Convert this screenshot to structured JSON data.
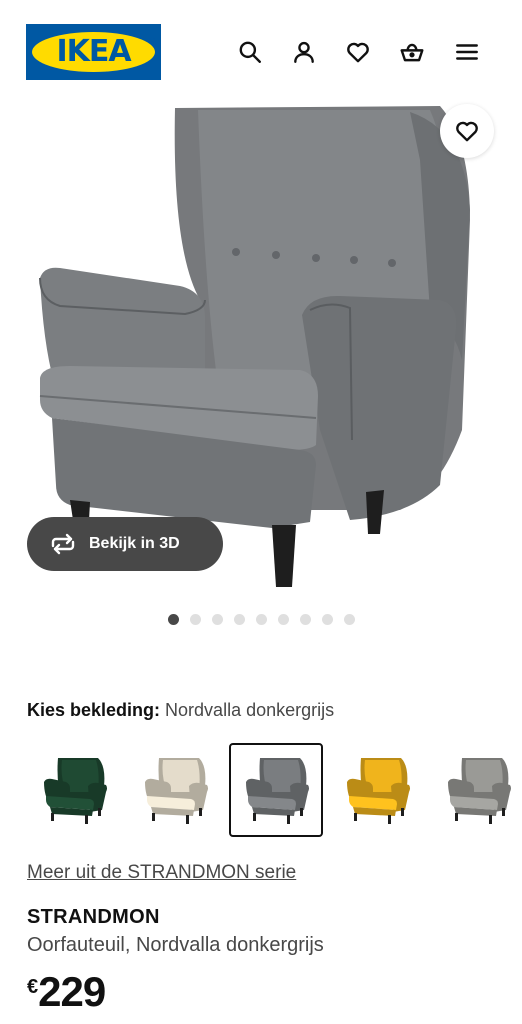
{
  "brand": {
    "logo_text": "IKEA",
    "colors": {
      "blue": "#0058a3",
      "yellow": "#ffdb00"
    }
  },
  "header": {
    "icons": [
      "search-icon",
      "account-icon",
      "favourites-heart-icon",
      "shopping-basket-icon",
      "hamburger-menu-icon"
    ]
  },
  "gallery": {
    "image_count": 9,
    "active_index": 0,
    "view_3d_label": "Bekijk in 3D",
    "favourite_icon": "heart-outline-icon"
  },
  "upholstery": {
    "label": "Kies bekleding:",
    "selected": "Nordvalla donkergrijs",
    "options": [
      {
        "color": "#1f4a33"
      },
      {
        "color": "#e4dccb"
      },
      {
        "color": "#7a7d80",
        "selected": true
      },
      {
        "color": "#f0b41c"
      },
      {
        "color": "#9a9a96"
      }
    ]
  },
  "product": {
    "series_link": "Meer uit de STRANDMON serie",
    "name": "STRANDMON",
    "description": "Oorfauteuil, Nordvalla donkergrijs",
    "price_currency": "€",
    "price_amount": "229"
  }
}
